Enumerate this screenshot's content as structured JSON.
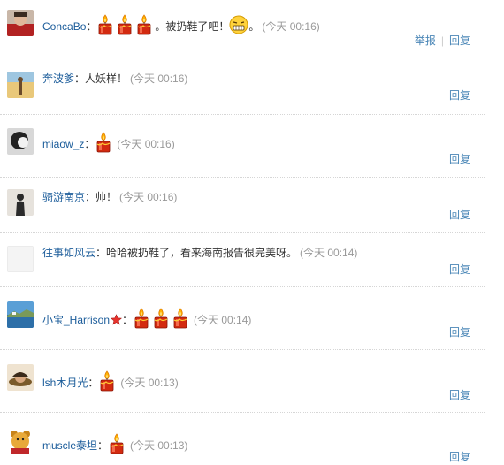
{
  "comments": [
    {
      "user": "ConcaBo",
      "colon": "：",
      "text_after": "。被扔鞋了吧！",
      "text_end": "。",
      "time": "(今天 00:16)",
      "report": "举报",
      "reply": "回复"
    },
    {
      "user": "奔波爹",
      "colon": "：",
      "text": "人妖样！",
      "time": "(今天 00:16)",
      "reply": "回复"
    },
    {
      "user": "miaow_z",
      "colon": "：",
      "time": "(今天 00:16)",
      "reply": "回复"
    },
    {
      "user": "骑游南京",
      "colon": "：",
      "text": "帅！",
      "time": "(今天 00:16)",
      "reply": "回复"
    },
    {
      "user": "往事如风云",
      "colon": "：",
      "text": "哈哈被扔鞋了，看来海南报告很完美呀。",
      "time": "(今天 00:14)",
      "reply": "回复"
    },
    {
      "user": "小宝_Harrison",
      "colon": "：",
      "time": "(今天 00:14)",
      "reply": "回复"
    },
    {
      "user": "lsh木月光",
      "colon": "：",
      "time": "(今天 00:13)",
      "reply": "回复"
    },
    {
      "user": "muscle泰坦",
      "colon": "：",
      "time": "(今天 00:13)",
      "reply": "回复"
    }
  ],
  "icons": {
    "candle": "candle-emoticon-icon",
    "face": "grimace-face-icon",
    "star": "vip-star-icon"
  },
  "colors": {
    "username": "#1b5c9a",
    "action": "#4b87b7",
    "time": "#999999",
    "candle_red": "#d32a10",
    "flame": "#ffb300"
  }
}
